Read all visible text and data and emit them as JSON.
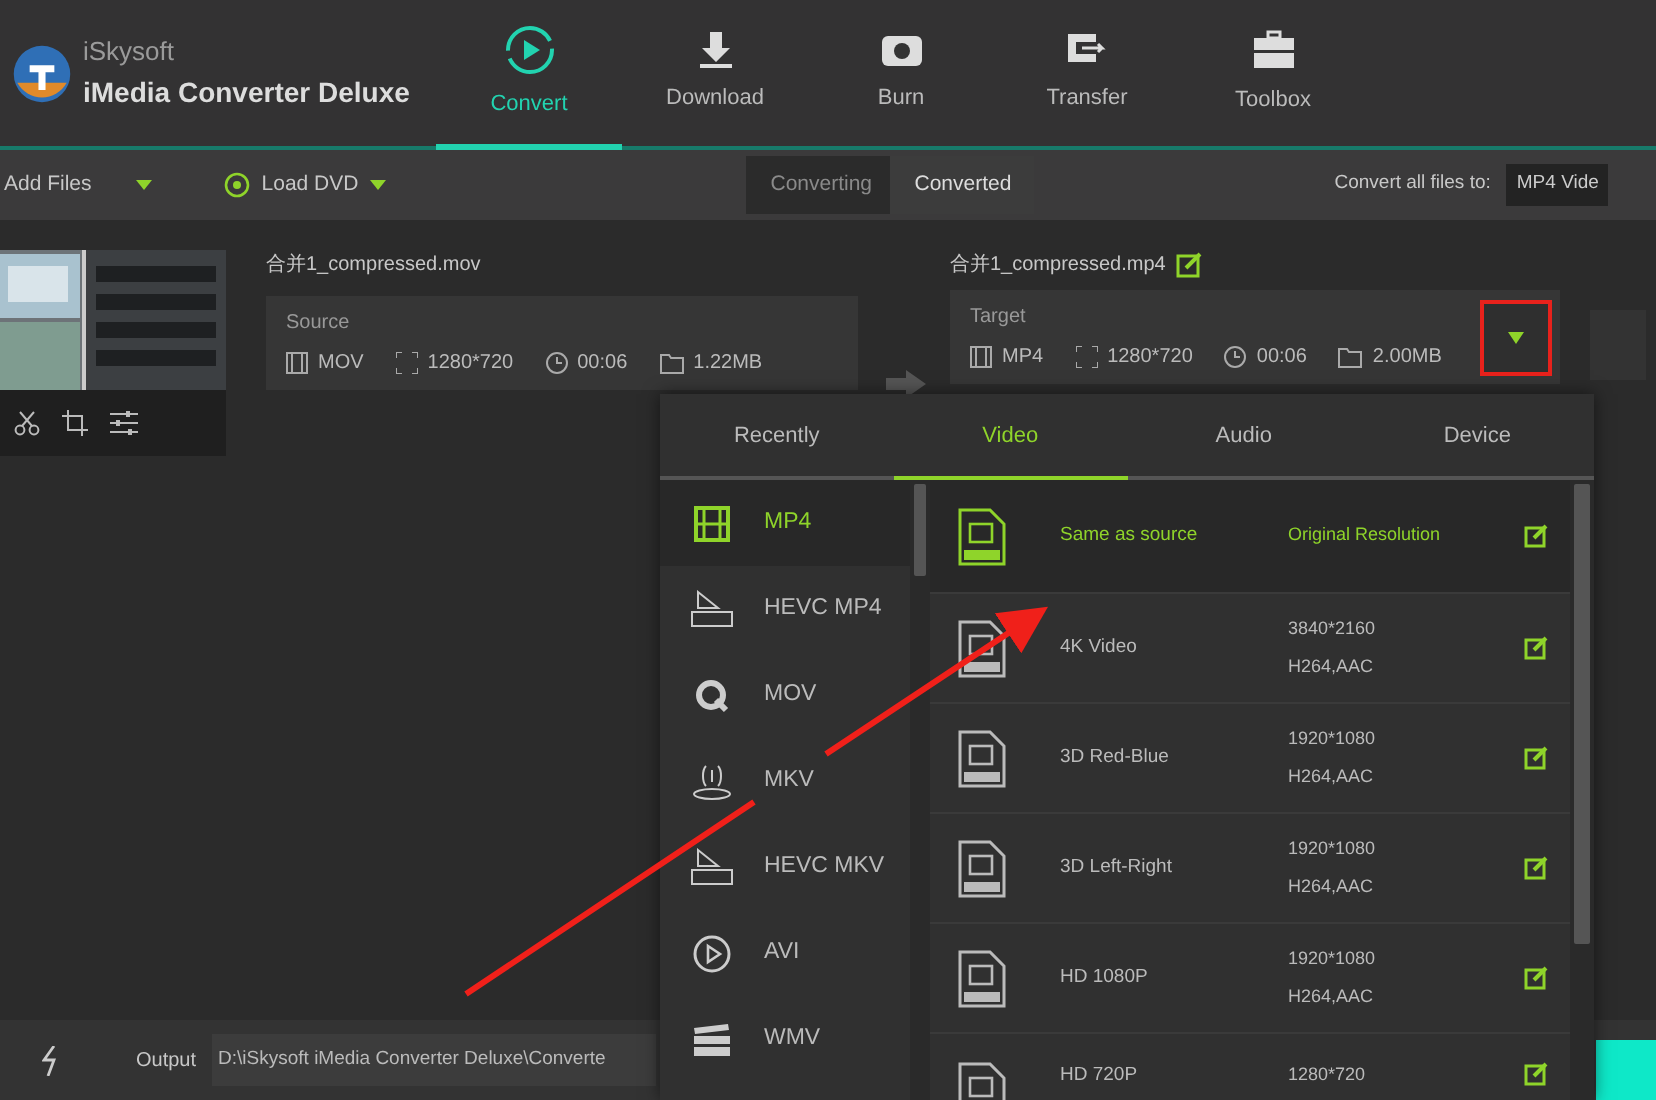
{
  "app": {
    "brand": "iSkysoft",
    "product": "iMedia Converter Deluxe"
  },
  "nav": [
    {
      "label": "Convert",
      "kind": "convert",
      "selected": true
    },
    {
      "label": "Download",
      "kind": "download",
      "selected": false
    },
    {
      "label": "Burn",
      "kind": "burn",
      "selected": false
    },
    {
      "label": "Transfer",
      "kind": "transfer",
      "selected": false
    },
    {
      "label": "Toolbox",
      "kind": "toolbox",
      "selected": false
    }
  ],
  "toolbar": {
    "add_files": "Add Files",
    "load_dvd": "Load DVD",
    "convert_all_label": "Convert all files to:",
    "convert_all_value": "MP4 Vide",
    "tabs": [
      {
        "label": "Converting",
        "selected": true
      },
      {
        "label": "Converted",
        "selected": false
      }
    ]
  },
  "file": {
    "source_name": "合并1_compressed.mov",
    "target_name": "合并1_compressed.mp4",
    "source": {
      "label": "Source",
      "format": "MOV",
      "resolution": "1280*720",
      "duration": "00:06",
      "size": "1.22MB"
    },
    "target": {
      "label": "Target",
      "format": "MP4",
      "resolution": "1280*720",
      "duration": "00:06",
      "size": "2.00MB"
    }
  },
  "dropdown": {
    "tabs": [
      {
        "label": "Recently",
        "selected": false
      },
      {
        "label": "Video",
        "selected": true
      },
      {
        "label": "Audio",
        "selected": false
      },
      {
        "label": "Device",
        "selected": false
      }
    ],
    "formats": [
      {
        "label": "MP4",
        "kind": "film",
        "selected": true
      },
      {
        "label": "HEVC MP4",
        "kind": "hevc",
        "selected": false
      },
      {
        "label": "MOV",
        "kind": "quicktime",
        "selected": false
      },
      {
        "label": "MKV",
        "kind": "mkv",
        "selected": false
      },
      {
        "label": "HEVC MKV",
        "kind": "hevc",
        "selected": false
      },
      {
        "label": "AVI",
        "kind": "play",
        "selected": false
      },
      {
        "label": "WMV",
        "kind": "clapper",
        "selected": false
      }
    ],
    "presets": [
      {
        "name": "Same as source",
        "resolution": "Original Resolution",
        "selected": true
      },
      {
        "name": "4K Video",
        "resolution": "3840*2160",
        "codec": "H264,AAC",
        "selected": false
      },
      {
        "name": "3D Red-Blue",
        "resolution": "1920*1080",
        "codec": "H264,AAC",
        "selected": false
      },
      {
        "name": "3D Left-Right",
        "resolution": "1920*1080",
        "codec": "H264,AAC",
        "selected": false
      },
      {
        "name": "HD 1080P",
        "resolution": "1920*1080",
        "codec": "H264,AAC",
        "selected": false
      },
      {
        "name": "HD 720P",
        "resolution": "1280*720",
        "selected": false
      }
    ]
  },
  "bottom": {
    "output_label": "Output",
    "output_path": "D:\\iSkysoft iMedia Converter Deluxe\\Converte"
  }
}
